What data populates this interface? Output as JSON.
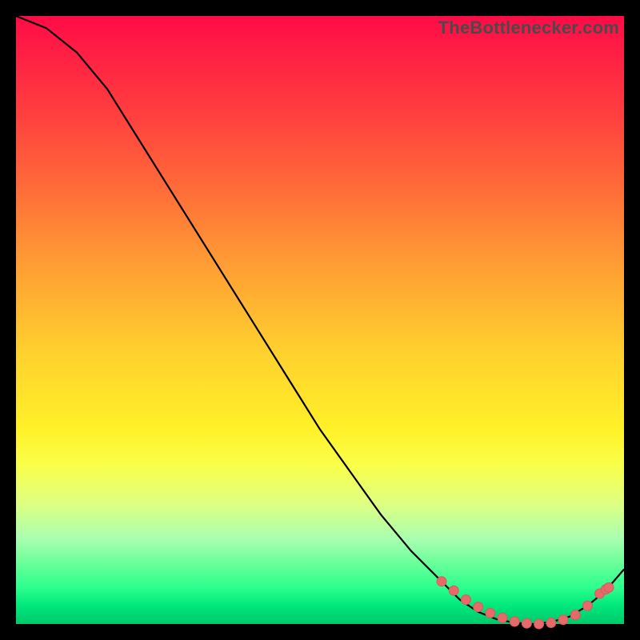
{
  "watermark": "TheBottlenecker.com",
  "colors": {
    "curve_stroke": "#000000",
    "marker_fill": "#e66a6a",
    "marker_stroke": "#d85a5a"
  },
  "chart_data": {
    "type": "line",
    "title": "",
    "xlabel": "",
    "ylabel": "",
    "xlim": [
      0,
      100
    ],
    "ylim": [
      0,
      100
    ],
    "x": [
      0,
      5,
      10,
      15,
      20,
      25,
      30,
      35,
      40,
      45,
      50,
      55,
      60,
      65,
      70,
      73,
      76,
      79,
      82,
      85,
      88,
      91,
      94,
      97,
      100
    ],
    "values": [
      100,
      98,
      94,
      88,
      80,
      72,
      64,
      56,
      48,
      40,
      32,
      25,
      18,
      12,
      7,
      4,
      2,
      0.8,
      0.2,
      0.0,
      0.3,
      1.2,
      3.0,
      5.5,
      9
    ],
    "markers_x": [
      70,
      72,
      74,
      76,
      78,
      80,
      82,
      84,
      86,
      88,
      90,
      92,
      94,
      96,
      97,
      97.5
    ],
    "markers_values": [
      7,
      5.5,
      4,
      2.8,
      1.8,
      1.0,
      0.4,
      0.1,
      0.0,
      0.2,
      0.7,
      1.5,
      3.0,
      5.0,
      5.7,
      6.0
    ]
  }
}
